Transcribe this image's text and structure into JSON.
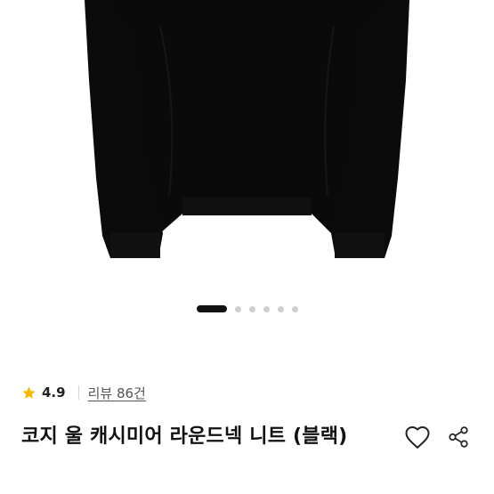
{
  "carousel": {
    "total": 6,
    "active_index": 0
  },
  "rating": {
    "value": "4.9",
    "star_color": "#F5B800"
  },
  "reviews": {
    "label": "리뷰 86건"
  },
  "product": {
    "title": "코지 울 캐시미어 라운드넥 니트 (블랙)",
    "image_color": "#0a0a0a"
  },
  "icons": {
    "like": "heart-outline-icon",
    "share": "share-icon"
  }
}
